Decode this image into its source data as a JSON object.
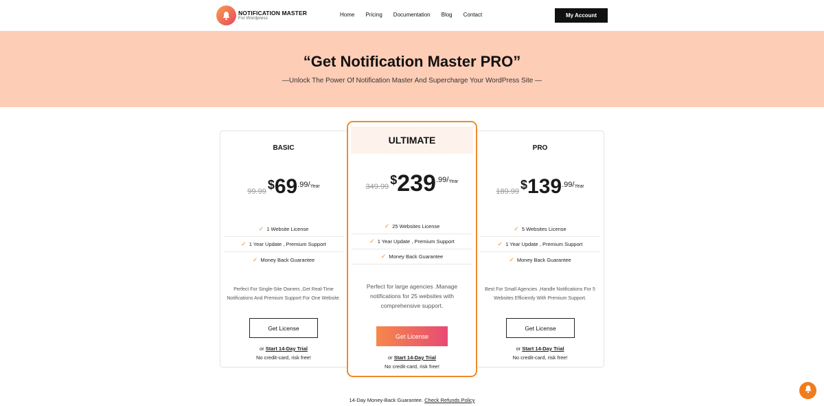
{
  "header": {
    "logo_name": "NOTIFICATION MASTER",
    "logo_sub": "For Wordpress",
    "nav": [
      "Home",
      "Pricing",
      "Documentation",
      "Blog",
      "Contact"
    ],
    "account_label": "My Account"
  },
  "hero": {
    "title": "“Get Notification Master PRO”",
    "subtitle": "—Unlock The Power Of  Notification Master And Supercharge Your WordPress Site —"
  },
  "plans": [
    {
      "name": "BASIC",
      "old_price": "99.99",
      "currency": "$",
      "price": "69",
      "cents": ".99/",
      "period": "Year",
      "features": [
        "1 Website License",
        "1 Year Update , Premium Support",
        "Money Back Guarantee"
      ],
      "description": "Perfect For Single-Site Owners ,Get Real-Time Notifications And Premium Support For One Website.",
      "button": "Get License",
      "trial_prefix": "or",
      "trial_link": "Start 14-Day Trial",
      "trial_note": "No credit-card, risk free!"
    },
    {
      "name": "ULTIMATE",
      "old_price": "349.99",
      "currency": "$",
      "price": "239",
      "cents": ".99/",
      "period": "Year",
      "features": [
        "25 Websites License",
        "1 Year Update , Premium Support",
        "Money Back Guarantee"
      ],
      "description": "Perfect for large agencies .Manage notifications for 25 websites with comprehensive support.",
      "button": "Get License",
      "trial_prefix": "or",
      "trial_link": "Start 14-Day Trial",
      "trial_note": "No credit-card, risk free!"
    },
    {
      "name": "PRO",
      "old_price": "189.99",
      "currency": "$",
      "price": "139",
      "cents": ".99/",
      "period": "Year",
      "features": [
        "5 Websites License",
        "1 Year Update , Premium Support",
        "Money Back Guarantee"
      ],
      "description": "Best For Small Agencies ,Handle Notifications For 5 Websites Efficiently With Premium Support.",
      "button": "Get License",
      "trial_prefix": "or",
      "trial_link": "Start 14-Day Trial",
      "trial_note": "No credit-card, risk free!"
    }
  ],
  "footer": {
    "guarantee_text": "14-Day Money-Back Guarantee.",
    "refund_link": "Check Refunds Policy"
  },
  "colors": {
    "accent": "#f08a2a",
    "hero_bg": "#fecdb6",
    "button_gradient_start": "#f6884b",
    "button_gradient_end": "#e84a73"
  },
  "icons": {
    "logo": "bell-icon",
    "feature": "check-icon",
    "floating": "bell-icon"
  }
}
